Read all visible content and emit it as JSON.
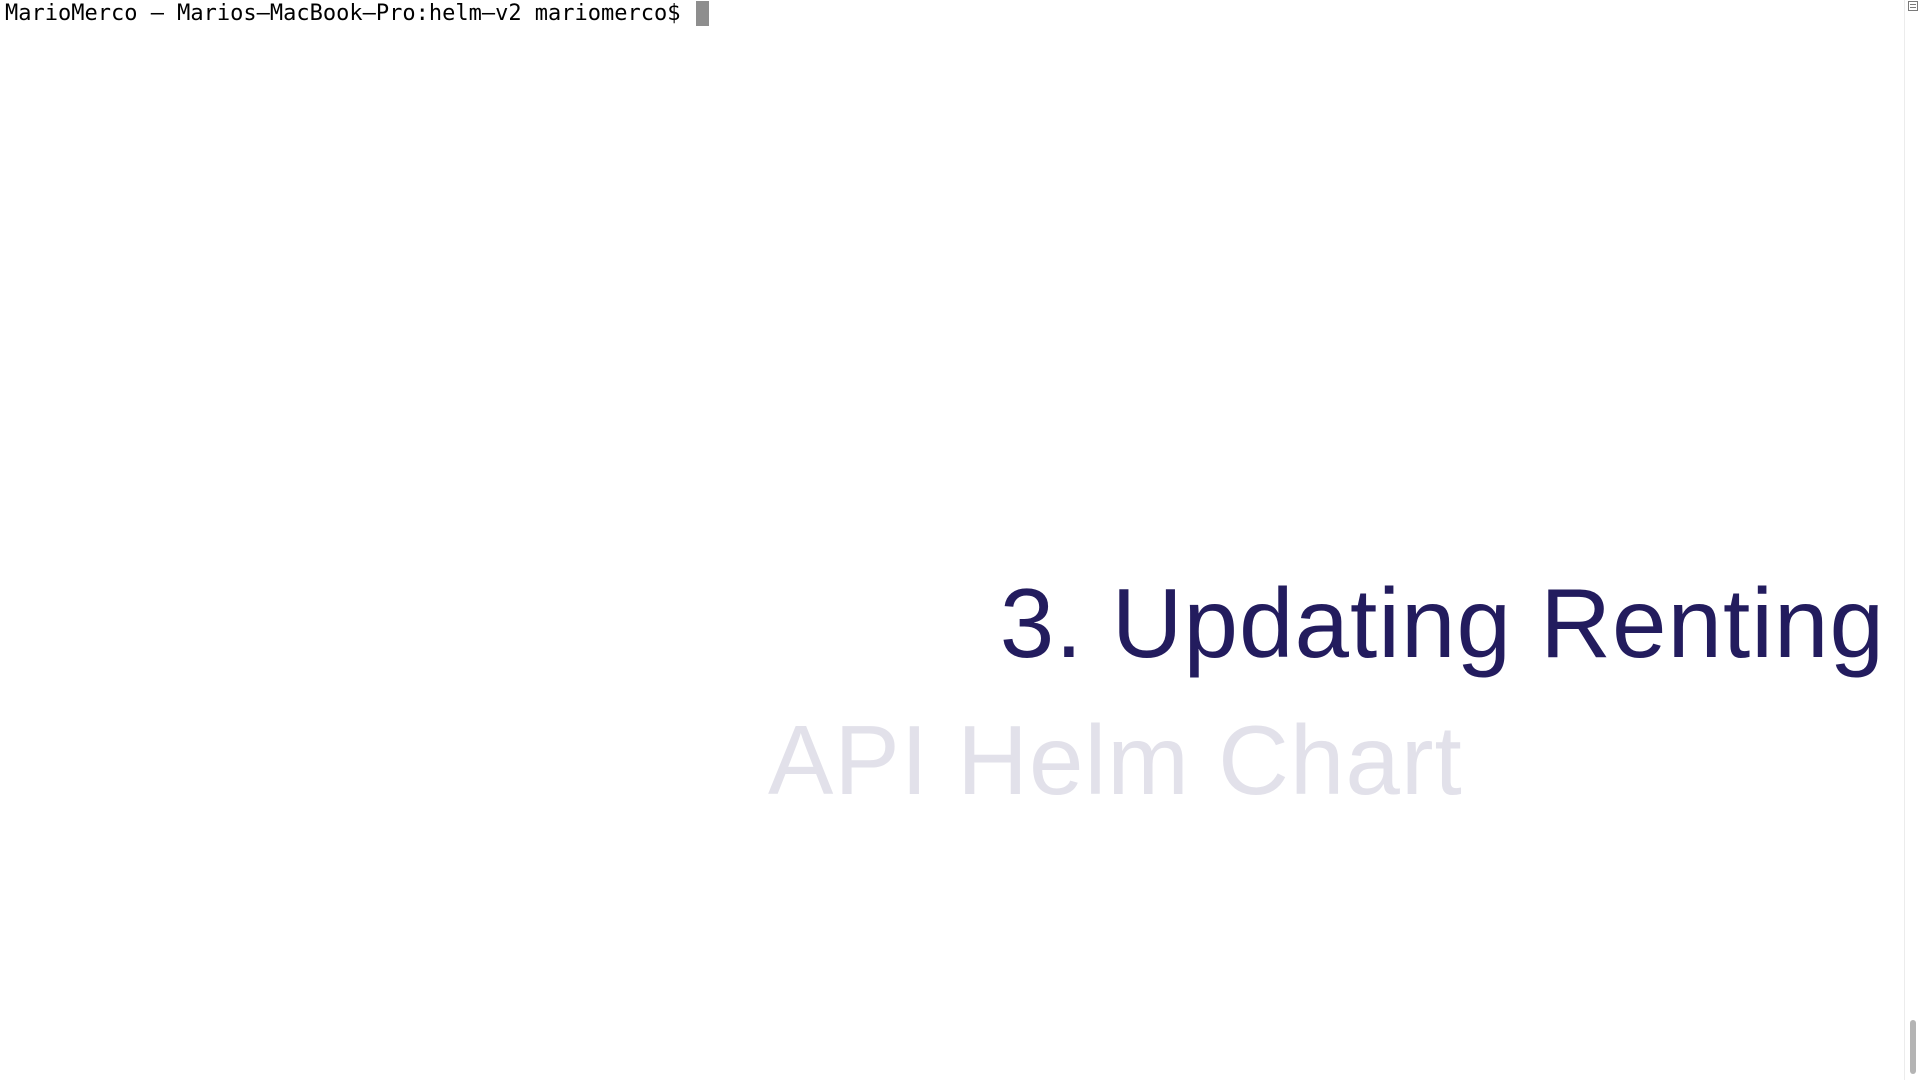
{
  "terminal": {
    "prompt": "MarioMerco — Marios—MacBook—Pro:helm—v2 mariomerco$ "
  },
  "overlay": {
    "title_line1": "3. Updating Renting",
    "title_line2": "API Helm Chart"
  },
  "colors": {
    "title_primary": "#231c5e",
    "title_faded": "#e2e1ea",
    "cursor": "#8e8e8e"
  }
}
